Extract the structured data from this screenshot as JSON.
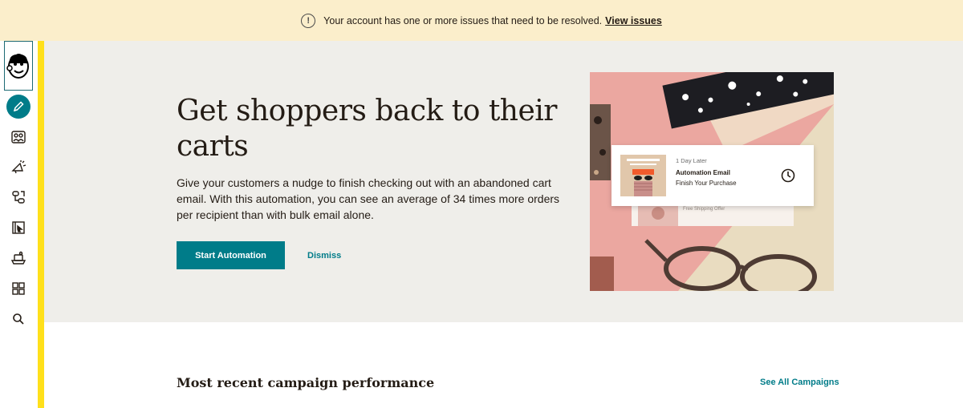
{
  "banner": {
    "icon": "warning-icon",
    "message": "Your account has one or more issues that need to be resolved.",
    "link_label": "View issues"
  },
  "sidebar": {
    "logo": "mailchimp-freddie-logo",
    "items": [
      {
        "icon": "pencil-icon",
        "active": true
      },
      {
        "icon": "audience-icon"
      },
      {
        "icon": "megaphone-icon"
      },
      {
        "icon": "automation-icon"
      },
      {
        "icon": "website-icon"
      },
      {
        "icon": "content-studio-icon"
      },
      {
        "icon": "integrations-grid-icon"
      },
      {
        "icon": "search-icon"
      }
    ]
  },
  "hero": {
    "title": "Get shoppers back to their carts",
    "description": "Give your customers a nudge to finish checking out with an abandoned cart email. With this automation, you can see an average of 34 times more orders per recipient than with bulk email alone.",
    "primary_button": "Start Automation",
    "secondary_button": "Dismiss",
    "image_card": {
      "delay": "1 Day Later",
      "title": "Automation Email",
      "subtitle": "Finish Your Purchase",
      "secondary_label": "Free Shipping Offer"
    }
  },
  "campaigns": {
    "title": "Most recent campaign performance",
    "see_all": "See All Campaigns"
  },
  "colors": {
    "accent": "#007c89",
    "banner_bg": "#fbeecb",
    "hero_bg": "#efeeea",
    "highlight": "#ffe01b"
  }
}
